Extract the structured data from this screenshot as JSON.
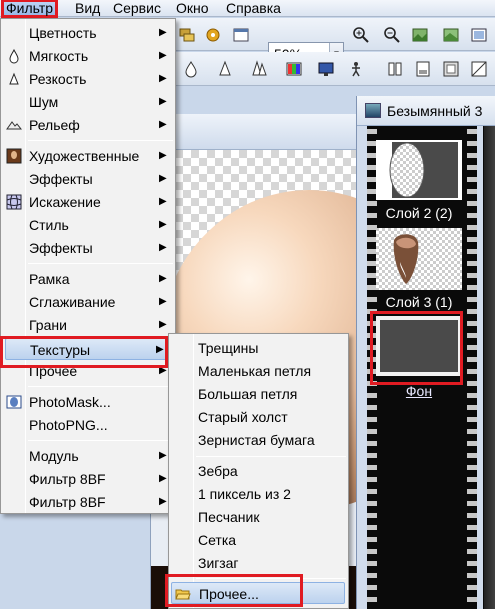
{
  "menubar": {
    "items": [
      {
        "label": "Фильтр"
      },
      {
        "label": "Вид"
      },
      {
        "label": "Сервис"
      },
      {
        "label": "Окно"
      },
      {
        "label": "Справка"
      }
    ]
  },
  "toolbar": {
    "zoom_value": "50%"
  },
  "layers_palette": {
    "title": "Безымянный 3",
    "layers": [
      {
        "label": "Слой 2 (2)"
      },
      {
        "label": "Слой 3 (1)"
      },
      {
        "label": "Фон"
      }
    ]
  },
  "filter_menu": {
    "items": [
      {
        "label": "Цветность",
        "submenu": true,
        "icon": ""
      },
      {
        "label": "Мягкость",
        "submenu": true,
        "icon": "drop-icon"
      },
      {
        "label": "Резкость",
        "submenu": true,
        "icon": "drop-outline-icon"
      },
      {
        "label": "Шум",
        "submenu": true,
        "icon": ""
      },
      {
        "label": "Рельеф",
        "submenu": true,
        "icon": "emboss-icon"
      },
      {
        "label": "Художественные",
        "submenu": true,
        "icon": "portrait-icon"
      },
      {
        "label": "Эффекты",
        "submenu": true,
        "icon": ""
      },
      {
        "label": "Искажение",
        "submenu": true,
        "icon": "grid-distort-icon"
      },
      {
        "label": "Стиль",
        "submenu": true,
        "icon": ""
      },
      {
        "label": "Эффекты",
        "submenu": true,
        "icon": ""
      },
      {
        "label": "Рамка",
        "submenu": true,
        "icon": ""
      },
      {
        "label": "Сглаживание",
        "submenu": true,
        "icon": ""
      },
      {
        "label": "Грани",
        "submenu": true,
        "icon": ""
      },
      {
        "label": "Текстуры",
        "submenu": true,
        "icon": ""
      },
      {
        "label": "Прочее",
        "submenu": true,
        "icon": ""
      },
      {
        "label": "PhotoMask...",
        "submenu": false,
        "icon": "photomask-icon"
      },
      {
        "label": "PhotoPNG...",
        "submenu": false,
        "icon": ""
      },
      {
        "label": "Модуль",
        "submenu": true,
        "icon": ""
      },
      {
        "label": "Фильтр 8BF",
        "submenu": true,
        "icon": ""
      },
      {
        "label": "Фильтр 8BF",
        "submenu": true,
        "icon": ""
      }
    ]
  },
  "textures_menu": {
    "items": [
      {
        "label": "Трещины"
      },
      {
        "label": "Маленькая петля"
      },
      {
        "label": "Большая петля"
      },
      {
        "label": "Старый холст"
      },
      {
        "label": "Зернистая бумага"
      },
      {
        "label": "Зебра"
      },
      {
        "label": "1 пиксель из 2"
      },
      {
        "label": "Песчаник"
      },
      {
        "label": "Сетка"
      },
      {
        "label": "Зигзаг"
      },
      {
        "label": "Прочее..."
      }
    ]
  },
  "colors": {
    "highlight_red": "#e01b22",
    "menu_bg": "#f2f2f2",
    "selection": "#bcd2ee"
  }
}
